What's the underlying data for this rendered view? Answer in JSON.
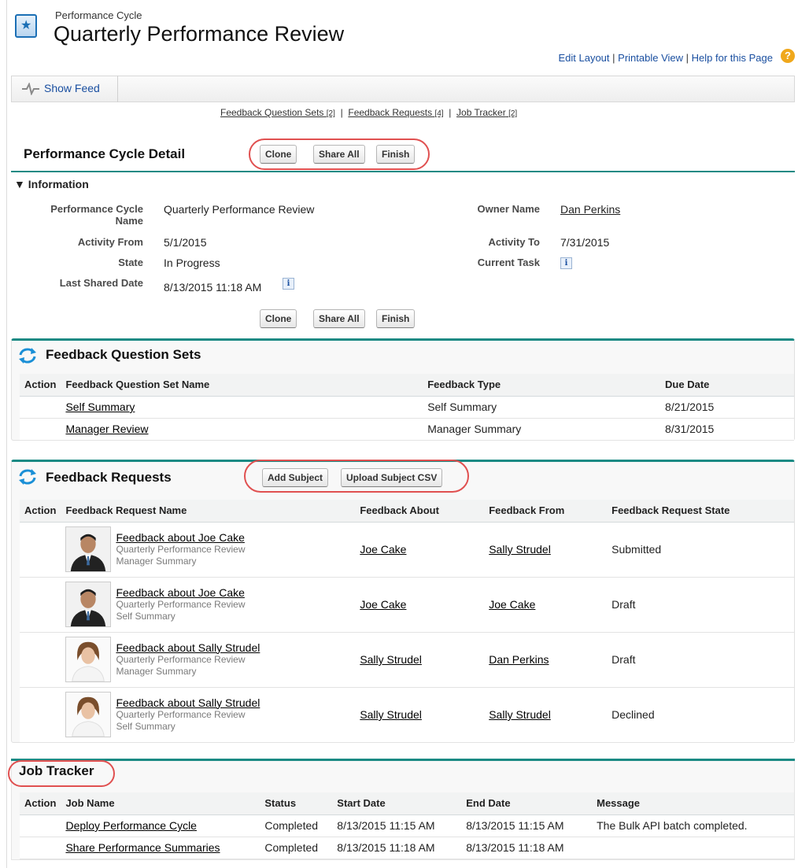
{
  "header": {
    "object_label": "Performance Cycle",
    "title": "Quarterly Performance Review",
    "links": [
      "Edit Layout",
      "Printable View",
      "Help for this Page"
    ],
    "help_icon": "?"
  },
  "feed": {
    "label": "Show Feed"
  },
  "related_links": [
    {
      "label": "Feedback Question Sets",
      "count": "[2]"
    },
    {
      "label": "Feedback Requests",
      "count": "[4]"
    },
    {
      "label": "Job Tracker",
      "count": "[2]"
    }
  ],
  "detail": {
    "title": "Performance Cycle Detail",
    "buttons": [
      "Clone",
      "Share All",
      "Finish"
    ],
    "section": "Information",
    "fields": {
      "cycle_name_label": "Performance Cycle Name",
      "cycle_name": "Quarterly Performance Review",
      "owner_label": "Owner Name",
      "owner": "Dan Perkins",
      "activity_from_label": "Activity From",
      "activity_from": "5/1/2015",
      "activity_to_label": "Activity To",
      "activity_to": "7/31/2015",
      "state_label": "State",
      "state": "In Progress",
      "current_task_label": "Current Task",
      "last_shared_label": "Last Shared Date",
      "last_shared": "8/13/2015 11:18 AM"
    },
    "info_glyph": "i"
  },
  "question_sets": {
    "title": "Feedback Question Sets",
    "columns": [
      "Action",
      "Feedback Question Set Name",
      "Feedback Type",
      "Due Date"
    ],
    "rows": [
      {
        "name": "Self Summary",
        "type": "Self Summary",
        "due": "8/21/2015"
      },
      {
        "name": "Manager Review",
        "type": "Manager Summary",
        "due": "8/31/2015"
      }
    ]
  },
  "requests": {
    "title": "Feedback Requests",
    "buttons": [
      "Add Subject",
      "Upload Subject CSV"
    ],
    "columns": [
      "Action",
      "Feedback Request Name",
      "Feedback About",
      "Feedback From",
      "Feedback Request State"
    ],
    "rows": [
      {
        "name": "Feedback about Joe Cake",
        "cycle": "Quarterly Performance Review",
        "kind": "Manager Summary",
        "about": "Joe Cake",
        "from": "Sally Strudel",
        "state": "Submitted",
        "avatar": "male"
      },
      {
        "name": "Feedback about Joe Cake",
        "cycle": "Quarterly Performance Review",
        "kind": "Self Summary",
        "about": "Joe Cake",
        "from": "Joe Cake",
        "state": "Draft",
        "avatar": "male"
      },
      {
        "name": "Feedback about Sally Strudel",
        "cycle": "Quarterly Performance Review",
        "kind": "Manager Summary",
        "about": "Sally Strudel",
        "from": "Dan Perkins",
        "state": "Draft",
        "avatar": "female"
      },
      {
        "name": "Feedback about Sally Strudel",
        "cycle": "Quarterly Performance Review",
        "kind": "Self Summary",
        "about": "Sally Strudel",
        "from": "Sally Strudel",
        "state": "Declined",
        "avatar": "female"
      }
    ]
  },
  "jobs": {
    "title": "Job Tracker",
    "columns": [
      "Action",
      "Job Name",
      "Status",
      "Start Date",
      "End Date",
      "Message"
    ],
    "rows": [
      {
        "name": "Deploy Performance Cycle",
        "status": "Completed",
        "start": "8/13/2015 11:15 AM",
        "end": "8/13/2015 11:15 AM",
        "message": "The Bulk API batch completed."
      },
      {
        "name": "Share Performance Summaries",
        "status": "Completed",
        "start": "8/13/2015 11:18 AM",
        "end": "8/13/2015 11:18 AM",
        "message": ""
      }
    ]
  },
  "colors": {
    "accent": "#1b8a84",
    "highlight": "#e05050",
    "link": "#1a4fa0"
  }
}
